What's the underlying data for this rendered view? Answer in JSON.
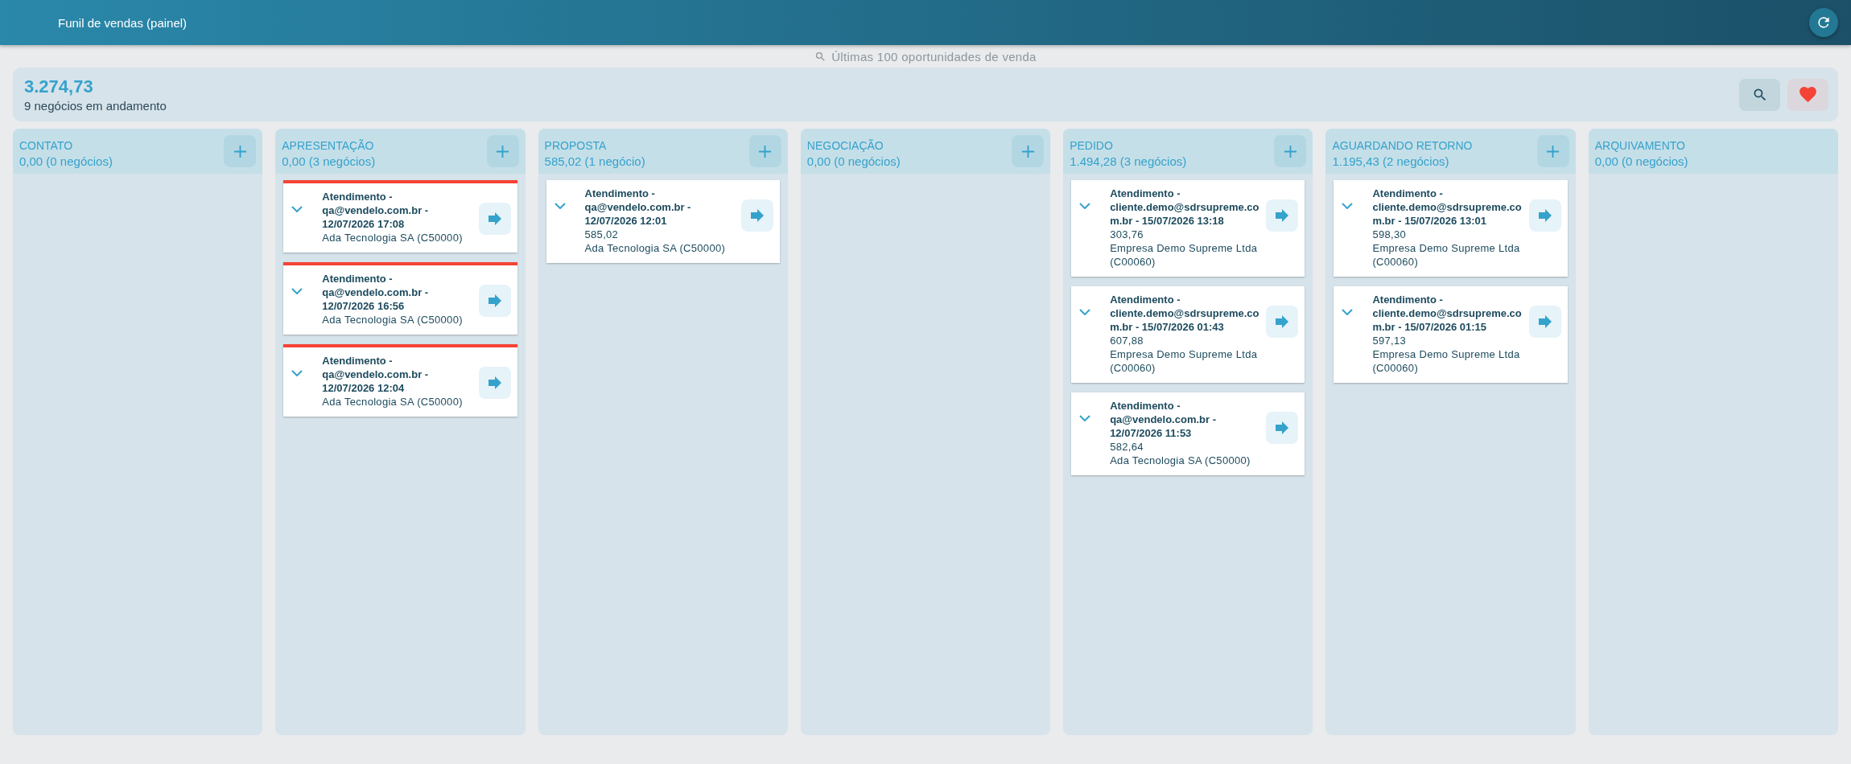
{
  "header": {
    "title": "Funil de vendas (painel)"
  },
  "search_hint": "Últimas 100 oportunidades de venda",
  "summary": {
    "total": "3.274,73",
    "subtitle": "9 negócios em andamento"
  },
  "columns": [
    {
      "name": "CONTATO",
      "total": "0,00 (0 negócios)",
      "can_add": true
    },
    {
      "name": "APRESENTAÇÃO",
      "total": "0,00 (3 negócios)",
      "can_add": true,
      "cards": [
        {
          "title": "Atendimento - qa@vendelo.com.br - 12/07/2026 17:08",
          "customer": "Ada Tecnologia SA (C50000)",
          "flagged": true
        },
        {
          "title": "Atendimento - qa@vendelo.com.br - 12/07/2026 16:56",
          "customer": "Ada Tecnologia SA (C50000)",
          "flagged": true
        },
        {
          "title": "Atendimento - qa@vendelo.com.br - 12/07/2026 12:04",
          "customer": "Ada Tecnologia SA (C50000)",
          "flagged": true
        }
      ]
    },
    {
      "name": "PROPOSTA",
      "total": "585,02 (1 negócio)",
      "can_add": true,
      "cards": [
        {
          "title": "Atendimento - qa@vendelo.com.br - 12/07/2026 12:01",
          "amount": "585,02",
          "customer": "Ada Tecnologia SA (C50000)",
          "flagged": false
        }
      ]
    },
    {
      "name": "NEGOCIAÇÃO",
      "total": "0,00 (0 negócios)",
      "can_add": true
    },
    {
      "name": "PEDIDO",
      "total": "1.494,28 (3 negócios)",
      "can_add": true,
      "cards": [
        {
          "title": "Atendimento - cliente.demo@sdrsupreme.com.br - 15/07/2026 13:18",
          "amount": "303,76",
          "customer": "Empresa Demo Supreme Ltda (C00060)",
          "flagged": false
        },
        {
          "title": "Atendimento - cliente.demo@sdrsupreme.com.br - 15/07/2026 01:43",
          "amount": "607,88",
          "customer": "Empresa Demo Supreme Ltda (C00060)",
          "flagged": false
        },
        {
          "title": "Atendimento - qa@vendelo.com.br - 12/07/2026 11:53",
          "amount": "582,64",
          "customer": "Ada Tecnologia SA (C50000)",
          "flagged": false
        }
      ]
    },
    {
      "name": "AGUARDANDO RETORNO",
      "total": "1.195,43 (2 negócios)",
      "can_add": true,
      "cards": [
        {
          "title": "Atendimento - cliente.demo@sdrsupreme.com.br - 15/07/2026 13:01",
          "amount": "598,30",
          "customer": "Empresa Demo Supreme Ltda (C00060)",
          "flagged": false
        },
        {
          "title": "Atendimento - cliente.demo@sdrsupreme.com.br - 15/07/2026 01:15",
          "amount": "597,13",
          "customer": "Empresa Demo Supreme Ltda (C00060)",
          "flagged": false
        }
      ]
    },
    {
      "name": "ARQUIVAMENTO",
      "total": "0,00 (0 negócios)",
      "can_add": false
    }
  ]
}
